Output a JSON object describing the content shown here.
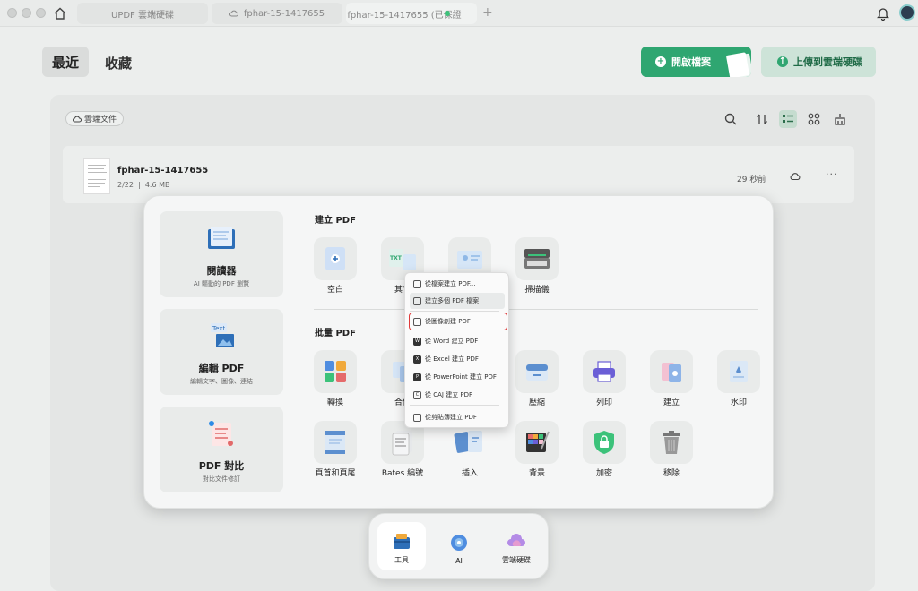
{
  "tabs": [
    {
      "label": "UPDF 雲端硬碟"
    },
    {
      "label": "fphar-15-1417655"
    },
    {
      "label": "fphar-15-1417655 (已保證"
    }
  ],
  "header": {
    "recent": "最近",
    "favorites": "收藏",
    "open_file": "開啟檔案",
    "upload": "上傳到雲端硬碟"
  },
  "filter": {
    "cloud_docs": "雲端文件"
  },
  "file": {
    "name": "fphar-15-1417655",
    "pages": "2/22",
    "size": "4.6 MB",
    "time": "29 秒前"
  },
  "features": [
    {
      "title": "閱讀器",
      "desc": "AI 驅動的 PDF 瀏覽"
    },
    {
      "title": "編輯 PDF",
      "desc": "編輯文字、圖像、連結"
    },
    {
      "title": "PDF 對比",
      "desc": "對比文件修訂"
    }
  ],
  "create_section": {
    "title": "建立 PDF",
    "tools": [
      "空白",
      "其它",
      "掃描儀"
    ]
  },
  "batch_section": {
    "title": "批量 PDF",
    "row1": [
      "轉換",
      "合併",
      "壓縮",
      "列印",
      "建立",
      "水印"
    ],
    "row2": [
      "頁首和頁尾",
      "Bates 編號",
      "插入",
      "背景",
      "加密",
      "移除"
    ]
  },
  "context_menu": [
    "從檔案建立 PDF...",
    "建立多個 PDF 檔案",
    "從圖像創建 PDF",
    "從 Word 建立 PDF",
    "從 Excel 建立 PDF",
    "從 PowerPoint 建立 PDF",
    "從 CAJ 建立 PDF",
    "從剪貼簿建立 PDF"
  ],
  "dock": [
    "工具",
    "AI",
    "雲端硬碟"
  ],
  "colors": {
    "accent_green": "#2fa671",
    "highlight_red": "#e03a3a"
  }
}
